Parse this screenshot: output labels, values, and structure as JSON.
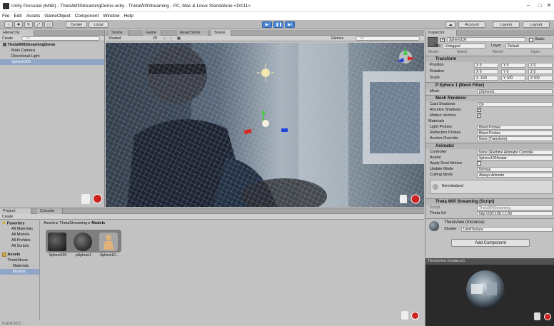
{
  "window": {
    "title": "Unity Personal (64bit) - ThetaWifiStreamingDemo.unity - ThetaWifiStreaming - PC, Mac & Linux Standalone <DX11>"
  },
  "menu": [
    "File",
    "Edit",
    "Assets",
    "GameObject",
    "Component",
    "Window",
    "Help"
  ],
  "toolbar": {
    "pivot": "Center",
    "space": "Local",
    "account": "Account",
    "layers": "Layers",
    "layout": "Layout"
  },
  "hierarchy": {
    "tab": "Hierarchy",
    "create": "Create",
    "search_placeholder": "All",
    "scene_name": "ThetaWifiStreamingDemo",
    "items": [
      "Main Camera",
      "Directional Light",
      "Sphere100"
    ]
  },
  "center_tabs": [
    "Scene",
    "Game",
    "Asset Store",
    "Scene"
  ],
  "scene": {
    "shading": "Shaded",
    "mode_2d": "2D",
    "gizmos": "Gizmos",
    "search_placeholder": "All"
  },
  "inspector": {
    "tab": "Inspector",
    "object_name": "Sphere100",
    "static_label": "Static",
    "tag_label": "Tag",
    "tag_value": "Untagged",
    "layer_label": "Layer",
    "layer_value": "Default",
    "model_buttons": [
      "Model",
      "Select",
      "Revert",
      "Open"
    ],
    "transform": {
      "title": "Transform",
      "position_label": "Position",
      "rotation_label": "Rotation",
      "scale_label": "Scale",
      "position": [
        "X 0",
        "Y 0",
        "Z 0"
      ],
      "rotation": [
        "X 0",
        "Y 0",
        "Z 0"
      ],
      "scale": [
        "X -100",
        "Y 100",
        "Z 100"
      ]
    },
    "mesh_filter": {
      "title": "P Sphere 1 (Mesh Filter)",
      "mesh_label": "Mesh",
      "mesh_value": "pSphere1"
    },
    "mesh_renderer": {
      "title": "Mesh Renderer",
      "cast_shadows_label": "Cast Shadows",
      "cast_shadows_value": "On",
      "receive_shadows_label": "Receive Shadows",
      "motion_vectors_label": "Motion Vectors",
      "materials_label": "Materials",
      "light_probes_label": "Light Probes",
      "light_probes_value": "Blend Probes",
      "reflection_probes_label": "Reflection Probes",
      "reflection_probes_value": "Blend Probes",
      "anchor_override_label": "Anchor Override",
      "anchor_override_value": "None (Transform)"
    },
    "animator": {
      "title": "Animator",
      "controller_label": "Controller",
      "controller_value": "None (Runtime Animator Controlle",
      "avatar_label": "Avatar",
      "avatar_value": "Sphere100Avatar",
      "apply_root_motion_label": "Apply Root Motion",
      "update_mode_label": "Update Mode",
      "update_mode_value": "Normal",
      "culling_mode_label": "Culling Mode",
      "culling_mode_value": "Always Animate",
      "status": "Not initialized"
    },
    "script": {
      "title": "Theta Wifi Streaming (Script)",
      "script_label": "Script",
      "script_value": "ThetaWifiStreaming",
      "url_label": "Theta Url",
      "url_value": "http://192.168.1.1:80"
    },
    "material": {
      "name": "ThetaView (Instance)",
      "shader_label": "Shader",
      "shader_value": "Unlit/Texture"
    },
    "add_component": "Add Component"
  },
  "preview": {
    "title": "ThetaView (Instance)"
  },
  "project": {
    "tabs": [
      "Project",
      "Console"
    ],
    "create": "Create",
    "favorites_label": "Favorites",
    "favorites": [
      "All Materials",
      "All Models",
      "All Prefabs",
      "All Scripts"
    ],
    "assets_label": "Assets",
    "assets_tree": [
      "ThetaStrear",
      "Materials",
      "Models"
    ],
    "breadcrumb": [
      "Assets",
      "ThetaStreaming",
      "Models"
    ],
    "assets": [
      "Sphere100",
      "pSphere1",
      "Sphere10..."
    ]
  },
  "status_bar": "© ETA 2017"
}
